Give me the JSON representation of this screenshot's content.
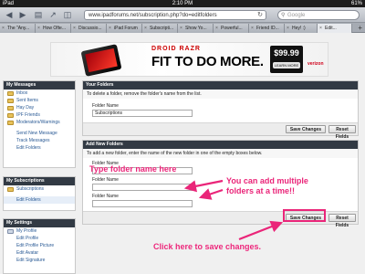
{
  "status": {
    "device": "iPad",
    "time": "2:10 PM",
    "battery": "61%"
  },
  "browser": {
    "url": "www.ipadforums.net/subscription.php?do=editfolders",
    "search_placeholder": "Google",
    "tabs": [
      {
        "label": "The \"Any..."
      },
      {
        "label": "How Ofte..."
      },
      {
        "label": "Discussio..."
      },
      {
        "label": "iPad Forum"
      },
      {
        "label": "Subscripti..."
      },
      {
        "label": "Show Yo..."
      },
      {
        "label": "Powerful..."
      },
      {
        "label": "Friend ID..."
      },
      {
        "label": "Hey! :)"
      },
      {
        "label": "Edit..."
      }
    ],
    "new_tab": "+"
  },
  "ad": {
    "brand": "DROID RAZR",
    "slogan": "FIT TO DO MORE.",
    "price": "$99.99",
    "learn_more": "LEARN MORE",
    "carrier": "verizon"
  },
  "sidebar": {
    "my_messages": {
      "title": "My Messages",
      "folders": [
        "Inbox",
        "Sent Items",
        "Hay Day",
        "IPF Friends",
        "Moderators/Warnings"
      ],
      "actions": [
        "Send New Message",
        "Track Messages",
        "Edit Folders"
      ]
    },
    "my_subscriptions": {
      "title": "My Subscriptions",
      "folders": [
        "Subscriptions"
      ],
      "actions": [
        "Edit Folders"
      ]
    },
    "my_settings": {
      "title": "My Settings",
      "items": [
        "My Profile",
        "Edit Profile",
        "Edit Profile Picture",
        "Edit Avatar",
        "Edit Signature"
      ]
    }
  },
  "your_folders": {
    "title": "Your Folders",
    "description": "To delete a folder, remove the folder's name from the list.",
    "field_label": "Folder Name",
    "field_value": "Subscriptions",
    "save_label": "Save Changes",
    "reset_label": "Reset Fields"
  },
  "add_folders": {
    "title": "Add New Folders",
    "description": "To add a new folder, enter the name of the new folder in one of the empty boxes below.",
    "field_label": "Folder Name",
    "save_label": "Save Changes",
    "reset_label": "Reset Fields"
  },
  "annotations": {
    "type_name": "Type folder name here",
    "multiple_line1": "You can add multiple",
    "multiple_line2": "folders at a time!!",
    "click_save": "Click here to save changes."
  },
  "colors": {
    "annotation": "#ea2579",
    "panel_header": "#323a44",
    "link": "#2a5a95"
  }
}
